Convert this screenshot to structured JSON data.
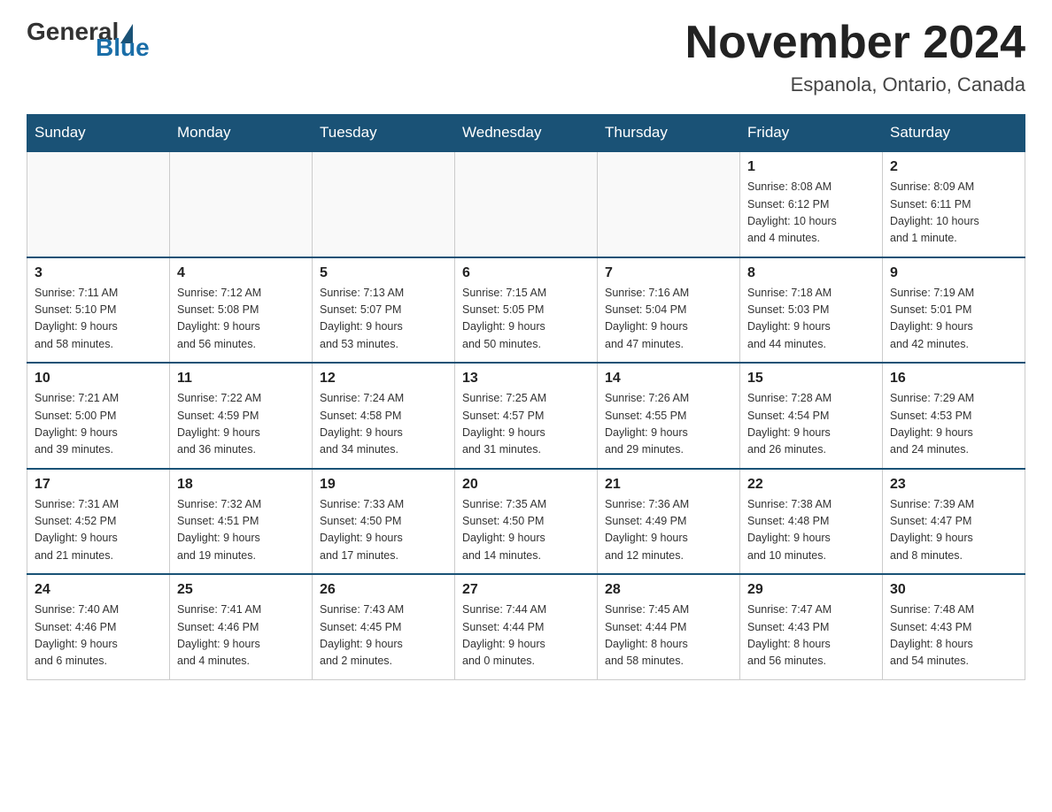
{
  "header": {
    "logo_general": "General",
    "logo_blue": "Blue",
    "month_year": "November 2024",
    "location": "Espanola, Ontario, Canada"
  },
  "days_of_week": [
    "Sunday",
    "Monday",
    "Tuesday",
    "Wednesday",
    "Thursday",
    "Friday",
    "Saturday"
  ],
  "weeks": [
    [
      {
        "day": "",
        "info": ""
      },
      {
        "day": "",
        "info": ""
      },
      {
        "day": "",
        "info": ""
      },
      {
        "day": "",
        "info": ""
      },
      {
        "day": "",
        "info": ""
      },
      {
        "day": "1",
        "info": "Sunrise: 8:08 AM\nSunset: 6:12 PM\nDaylight: 10 hours\nand 4 minutes."
      },
      {
        "day": "2",
        "info": "Sunrise: 8:09 AM\nSunset: 6:11 PM\nDaylight: 10 hours\nand 1 minute."
      }
    ],
    [
      {
        "day": "3",
        "info": "Sunrise: 7:11 AM\nSunset: 5:10 PM\nDaylight: 9 hours\nand 58 minutes."
      },
      {
        "day": "4",
        "info": "Sunrise: 7:12 AM\nSunset: 5:08 PM\nDaylight: 9 hours\nand 56 minutes."
      },
      {
        "day": "5",
        "info": "Sunrise: 7:13 AM\nSunset: 5:07 PM\nDaylight: 9 hours\nand 53 minutes."
      },
      {
        "day": "6",
        "info": "Sunrise: 7:15 AM\nSunset: 5:05 PM\nDaylight: 9 hours\nand 50 minutes."
      },
      {
        "day": "7",
        "info": "Sunrise: 7:16 AM\nSunset: 5:04 PM\nDaylight: 9 hours\nand 47 minutes."
      },
      {
        "day": "8",
        "info": "Sunrise: 7:18 AM\nSunset: 5:03 PM\nDaylight: 9 hours\nand 44 minutes."
      },
      {
        "day": "9",
        "info": "Sunrise: 7:19 AM\nSunset: 5:01 PM\nDaylight: 9 hours\nand 42 minutes."
      }
    ],
    [
      {
        "day": "10",
        "info": "Sunrise: 7:21 AM\nSunset: 5:00 PM\nDaylight: 9 hours\nand 39 minutes."
      },
      {
        "day": "11",
        "info": "Sunrise: 7:22 AM\nSunset: 4:59 PM\nDaylight: 9 hours\nand 36 minutes."
      },
      {
        "day": "12",
        "info": "Sunrise: 7:24 AM\nSunset: 4:58 PM\nDaylight: 9 hours\nand 34 minutes."
      },
      {
        "day": "13",
        "info": "Sunrise: 7:25 AM\nSunset: 4:57 PM\nDaylight: 9 hours\nand 31 minutes."
      },
      {
        "day": "14",
        "info": "Sunrise: 7:26 AM\nSunset: 4:55 PM\nDaylight: 9 hours\nand 29 minutes."
      },
      {
        "day": "15",
        "info": "Sunrise: 7:28 AM\nSunset: 4:54 PM\nDaylight: 9 hours\nand 26 minutes."
      },
      {
        "day": "16",
        "info": "Sunrise: 7:29 AM\nSunset: 4:53 PM\nDaylight: 9 hours\nand 24 minutes."
      }
    ],
    [
      {
        "day": "17",
        "info": "Sunrise: 7:31 AM\nSunset: 4:52 PM\nDaylight: 9 hours\nand 21 minutes."
      },
      {
        "day": "18",
        "info": "Sunrise: 7:32 AM\nSunset: 4:51 PM\nDaylight: 9 hours\nand 19 minutes."
      },
      {
        "day": "19",
        "info": "Sunrise: 7:33 AM\nSunset: 4:50 PM\nDaylight: 9 hours\nand 17 minutes."
      },
      {
        "day": "20",
        "info": "Sunrise: 7:35 AM\nSunset: 4:50 PM\nDaylight: 9 hours\nand 14 minutes."
      },
      {
        "day": "21",
        "info": "Sunrise: 7:36 AM\nSunset: 4:49 PM\nDaylight: 9 hours\nand 12 minutes."
      },
      {
        "day": "22",
        "info": "Sunrise: 7:38 AM\nSunset: 4:48 PM\nDaylight: 9 hours\nand 10 minutes."
      },
      {
        "day": "23",
        "info": "Sunrise: 7:39 AM\nSunset: 4:47 PM\nDaylight: 9 hours\nand 8 minutes."
      }
    ],
    [
      {
        "day": "24",
        "info": "Sunrise: 7:40 AM\nSunset: 4:46 PM\nDaylight: 9 hours\nand 6 minutes."
      },
      {
        "day": "25",
        "info": "Sunrise: 7:41 AM\nSunset: 4:46 PM\nDaylight: 9 hours\nand 4 minutes."
      },
      {
        "day": "26",
        "info": "Sunrise: 7:43 AM\nSunset: 4:45 PM\nDaylight: 9 hours\nand 2 minutes."
      },
      {
        "day": "27",
        "info": "Sunrise: 7:44 AM\nSunset: 4:44 PM\nDaylight: 9 hours\nand 0 minutes."
      },
      {
        "day": "28",
        "info": "Sunrise: 7:45 AM\nSunset: 4:44 PM\nDaylight: 8 hours\nand 58 minutes."
      },
      {
        "day": "29",
        "info": "Sunrise: 7:47 AM\nSunset: 4:43 PM\nDaylight: 8 hours\nand 56 minutes."
      },
      {
        "day": "30",
        "info": "Sunrise: 7:48 AM\nSunset: 4:43 PM\nDaylight: 8 hours\nand 54 minutes."
      }
    ]
  ]
}
